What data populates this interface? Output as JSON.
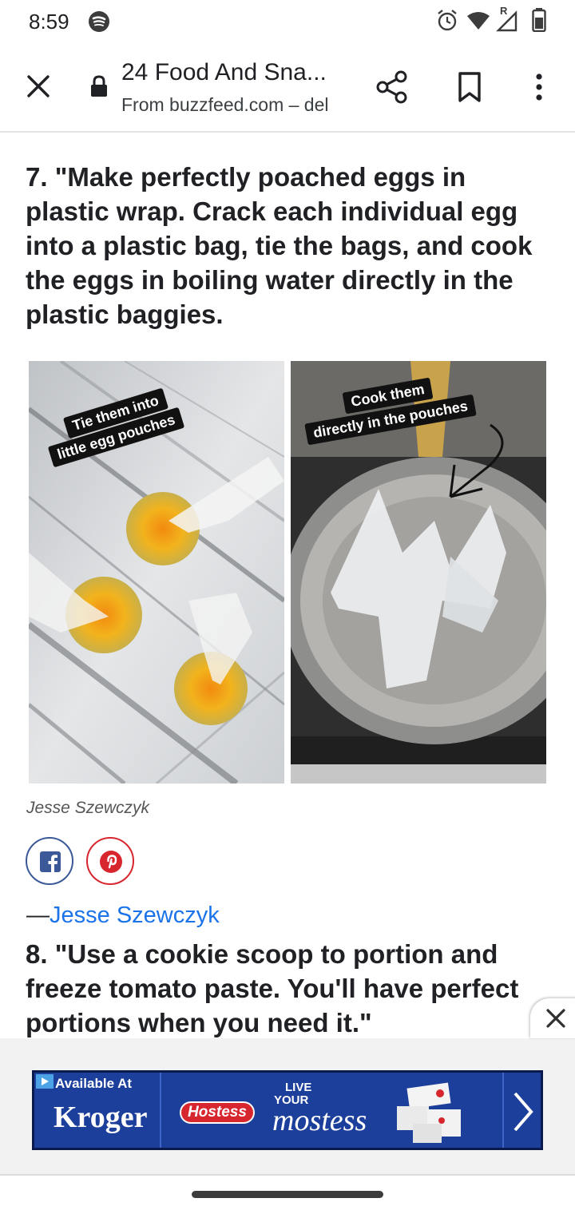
{
  "status_bar": {
    "time": "8:59",
    "icons": [
      "spotify-icon",
      "alarm-icon",
      "wifi-icon",
      "signal-icon",
      "battery-icon"
    ],
    "signal_badge": "R"
  },
  "toolbar": {
    "title": "24 Food And Sna...",
    "url": "From buzzfeed.com – del",
    "icons": [
      "close-icon",
      "lock-icon",
      "share-icon",
      "bookmark-icon",
      "more-vert-icon"
    ]
  },
  "article": {
    "item7_heading": "7. \"Make perfectly poached eggs in plastic wrap. Crack each individual egg into a plastic bag, tie the bags, and cook the eggs in boiling water directly in the plastic baggies.",
    "photo_left": {
      "caption_line1": "Tie them into",
      "caption_line2": "little egg pouches"
    },
    "photo_right": {
      "caption_line1": "Cook them",
      "caption_line2": "directly in the pouches"
    },
    "photo_credit": "Jesse Szewczyk",
    "share_buttons": [
      "facebook-icon",
      "pinterest-icon"
    ],
    "attribution_dash": "—",
    "attribution_name": "Jesse Szewczyk",
    "item8_heading": "8. \"Use a cookie scoop to portion and freeze tomato paste. You'll have perfect portions when you need it.\""
  },
  "ad": {
    "available_at": "Available At",
    "retailer": "Kroger",
    "brand": "Hostess",
    "tagline_top": "LIVE",
    "tagline_mid": "YOUR",
    "tagline_script": "mostess",
    "colors": {
      "banner": "#1d3f9c",
      "brand_red": "#d7262e"
    }
  },
  "colors": {
    "link": "#1a73e8",
    "facebook": "#3b5998",
    "pinterest": "#d7262e"
  }
}
